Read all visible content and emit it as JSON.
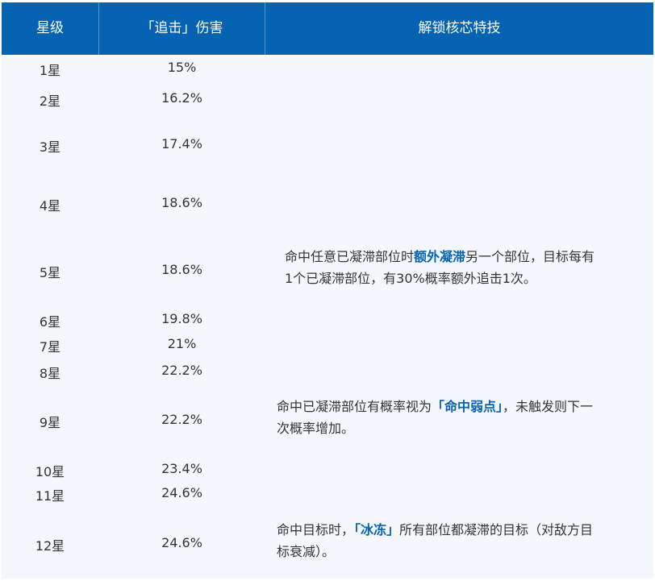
{
  "headers": [
    "星级",
    "「追击」伤害",
    "解锁核芯特技"
  ],
  "rows": [
    {
      "star": "1星",
      "damage": "15%"
    },
    {
      "star": "2星",
      "damage": "16.2%"
    },
    {
      "star": "3星",
      "damage": "17.4%"
    },
    {
      "star": "4星",
      "damage": "18.6%"
    },
    {
      "star": "5星",
      "damage": "18.6%"
    },
    {
      "star": "6星",
      "damage": "19.8%"
    },
    {
      "star": "7星",
      "damage": "21%"
    },
    {
      "star": "8星",
      "damage": "22.2%"
    },
    {
      "star": "9星",
      "damage": "22.2%"
    },
    {
      "star": "10星",
      "damage": "23.4%"
    },
    {
      "star": "11星",
      "damage": "24.6%"
    },
    {
      "star": "12星",
      "damage": "24.6%"
    }
  ],
  "skills": {
    "star5": {
      "line1_before": "命中任意已凝滞部位时",
      "line1_highlight": "额外凝滞",
      "line1_after": "另一个部位，目标每有",
      "line2": "1个已凝滞部位，有30%概率额外追击1次。"
    },
    "star9": {
      "line1_before": "命中已凝滞部位有概率视为",
      "line1_highlight": "「命中弱点」",
      "line1_after": "，未触发则下一",
      "line2": "次概率增加。"
    },
    "star12": {
      "line1_before": "命中目标时，",
      "line1_highlight": "「冰冻」",
      "line1_after": "所有部位都凝滞的目标（对敌方目",
      "line2": "标衰减）。"
    }
  },
  "colors": {
    "header_bg": "#0563b1",
    "highlight": "#0563b1",
    "row_bg": "#f4f8fc"
  }
}
